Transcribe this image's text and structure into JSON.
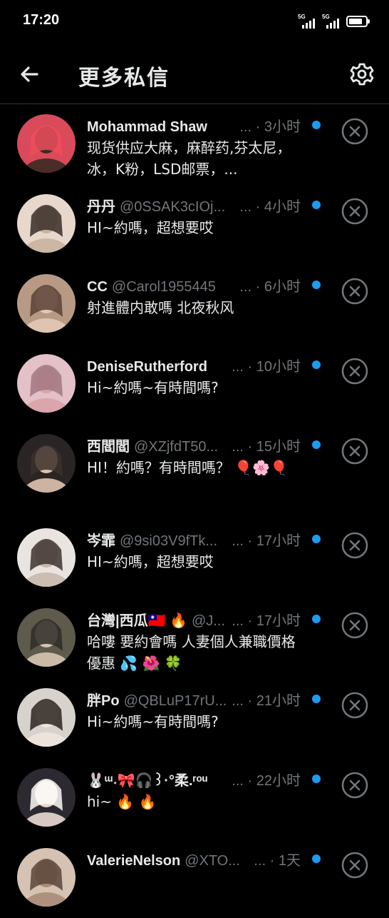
{
  "status_bar": {
    "time": "17:20",
    "signal1_label": "5G",
    "signal2_label": "5G",
    "battery_level": 0.8
  },
  "header": {
    "title": "更多私信",
    "back_icon": "arrow-left-icon",
    "settings_icon": "gear-icon"
  },
  "accent_color": "#1d9bf0",
  "messages": [
    {
      "name": "Mohammad Shaw",
      "handle": "",
      "time": "3小时",
      "preview": "现货供应大麻，麻醉药,芬太尼，冰，K粉，LSD邮票，..."
    },
    {
      "name": "丹丹",
      "handle": "@0SSAK3cIOj...",
      "time": "4小时",
      "preview": "HI~約嗎，超想要哎"
    },
    {
      "name": "CC",
      "handle": "@Carol1955445",
      "time": "6小时",
      "preview": "射進體内敢嗎 北夜秋风"
    },
    {
      "name": "DeniseRutherford",
      "handle": "",
      "time": "10小时",
      "preview": "Hi~約嗎~有時間嗎?"
    },
    {
      "name": "西閻閻",
      "handle": "@XZjfdT50...",
      "time": "15小时",
      "preview": "HI！約嗎？有時間嗎？ 🎈🌸🎈"
    },
    {
      "name": "岑霏",
      "handle": "@9si03V9fTk...",
      "time": "17小时",
      "preview": "HI~約嗎，超想要哎"
    },
    {
      "name": "台灣|西瓜🇹🇼 🔥",
      "handle": "@J...",
      "time": "17小时",
      "preview": "哈嘍 要約會嗎 人妻個人兼職價格優惠 💦 🌺 🍀"
    },
    {
      "name": "胖Po",
      "handle": "@QBLuP17rU...",
      "time": "21小时",
      "preview": "Hi~約嗎~有時間嗎?"
    },
    {
      "name": "🐰ᵚ˖🎀🎧꒱·°柔.ʳᵒᵘ",
      "handle": "",
      "time": "22小时",
      "preview": "hi~ 🔥 🔥"
    },
    {
      "name": "ValerieNelson",
      "handle": "@XTO...",
      "time": "1天",
      "preview": ""
    }
  ]
}
